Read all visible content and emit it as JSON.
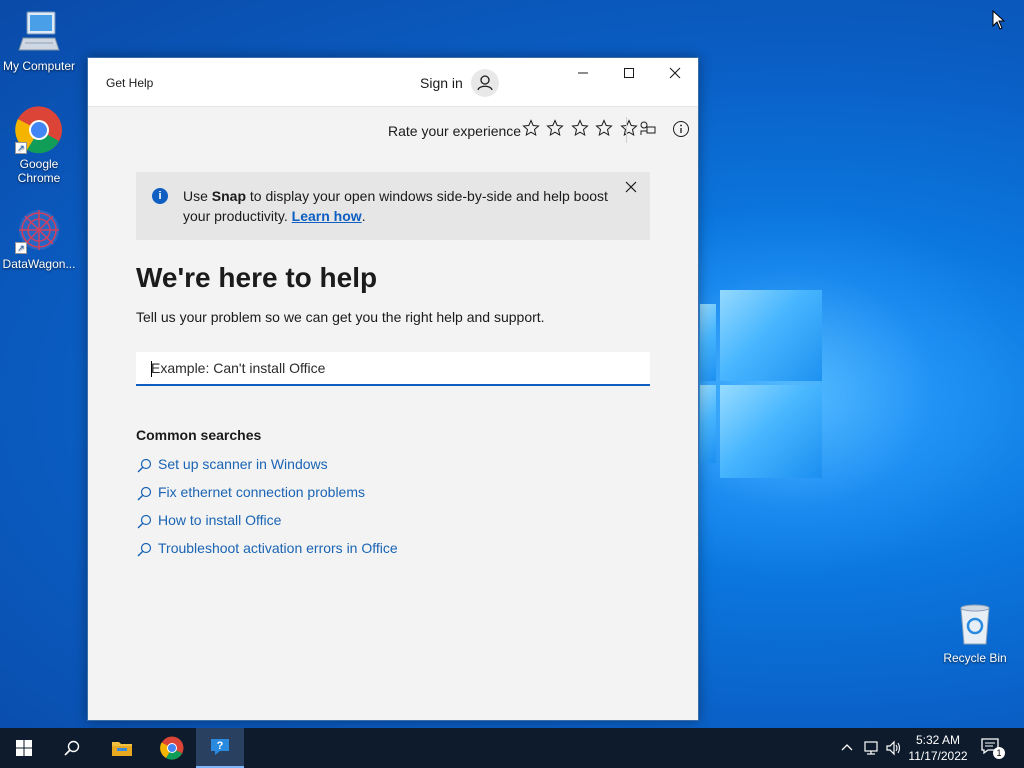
{
  "desktop": {
    "icons": [
      {
        "label": "My Computer",
        "icon": "computer-icon"
      },
      {
        "label": "Google Chrome",
        "icon": "chrome-icon"
      },
      {
        "label": "DataWagon...",
        "icon": "datawagon-icon"
      },
      {
        "label": "Recycle Bin",
        "icon": "recycle-bin-icon"
      }
    ]
  },
  "window": {
    "title": "Get Help",
    "sign_in_label": "Sign in",
    "controls": {
      "minimize": "minimize-icon",
      "maximize": "maximize-icon",
      "close": "close-icon"
    },
    "rating": {
      "label": "Rate your experience",
      "stars_total": 5,
      "stars_selected": 0
    },
    "banner": {
      "prefix": "Use ",
      "bold": "Snap",
      "text": " to display your open windows side-by-side and help boost your productivity. ",
      "link": "Learn how",
      "suffix": "."
    },
    "heading": "We're here to help",
    "subtext": "Tell us your problem so we can get you the right help and support.",
    "search": {
      "placeholder": "Example: Can't install Office",
      "value": ""
    },
    "common_searches": {
      "title": "Common searches",
      "items": [
        "Set up scanner in Windows",
        "Fix ethernet connection problems",
        "How to install Office",
        "Troubleshoot activation errors in Office"
      ]
    }
  },
  "taskbar": {
    "time": "5:32 AM",
    "date": "11/17/2022",
    "notification_count": "1",
    "pinned": [
      "start-icon",
      "search-icon",
      "file-explorer-icon",
      "chrome-icon",
      "get-help-icon"
    ]
  },
  "colors": {
    "accent": "#0f5ec2",
    "link": "#1a64b4",
    "taskbar": "#0e1b2c",
    "wallpaper": "#0a64c8"
  }
}
